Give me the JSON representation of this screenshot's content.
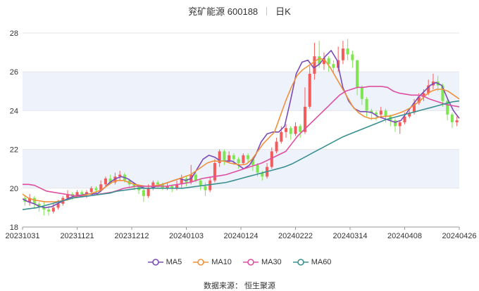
{
  "header": {
    "title": "兖矿能源 600188",
    "period": "日K"
  },
  "source": {
    "text": "数据来源：   恒生聚源"
  },
  "chart_data": {
    "type": "candlestick",
    "title": "兖矿能源 600188",
    "period": "日K",
    "ylim": [
      18,
      28
    ],
    "yticks": [
      "18",
      "20",
      "22",
      "24",
      "26",
      "28"
    ],
    "xtick_labels": [
      "20231031",
      "20231121",
      "20231212",
      "20240103",
      "20240124",
      "20240222",
      "20240314",
      "20240408",
      "20240426"
    ],
    "grid": true,
    "legend_position": "bottom",
    "colors": {
      "up": "#f45b5b",
      "down": "#7ee651",
      "axis": "#333333",
      "grid": "#e6e6e6",
      "band": "#eef2fb"
    },
    "series": [
      {
        "name": "MA5",
        "color": "#7b4bb7",
        "values": [
          19.45,
          19.3,
          19.2,
          19.05,
          19.0,
          19.05,
          19.2,
          19.35,
          19.5,
          19.6,
          19.65,
          19.7,
          19.7,
          19.75,
          20.0,
          20.3,
          20.5,
          20.6,
          20.5,
          20.3,
          20.1,
          20.0,
          20.0,
          20.1,
          20.2,
          20.3,
          20.4,
          20.5,
          20.4,
          20.5,
          21.0,
          21.5,
          21.7,
          21.6,
          21.4,
          21.4,
          21.4,
          21.2,
          21.0,
          21.2,
          21.7,
          22.4,
          22.8,
          22.9,
          22.9,
          23.2,
          24.5,
          25.9,
          26.5,
          26.6,
          26.2,
          26.4,
          26.8,
          27.1,
          26.6,
          25.2,
          24.5,
          24.1,
          23.95,
          23.95,
          23.9,
          23.7,
          23.6,
          23.5,
          23.4,
          23.5,
          23.9,
          24.3,
          24.7,
          25.0,
          25.3,
          25.45,
          25.3,
          24.6,
          24.0,
          23.6
        ]
      },
      {
        "name": "MA10",
        "color": "#f0913b",
        "values": [
          19.7,
          19.5,
          19.4,
          19.35,
          19.3,
          19.3,
          19.3,
          19.35,
          19.4,
          19.5,
          19.6,
          19.65,
          19.7,
          19.8,
          19.9,
          20.1,
          20.3,
          20.4,
          20.4,
          20.3,
          20.2,
          20.15,
          20.1,
          20.1,
          20.15,
          20.2,
          20.3,
          20.4,
          20.5,
          20.6,
          20.7,
          20.9,
          21.1,
          21.3,
          21.4,
          21.4,
          21.4,
          21.3,
          21.25,
          21.2,
          21.25,
          21.5,
          21.9,
          22.3,
          22.6,
          22.9,
          23.7,
          24.5,
          25.2,
          25.8,
          26.1,
          26.3,
          26.5,
          26.7,
          26.6,
          26.2,
          25.7,
          25.2,
          24.7,
          24.2,
          23.9,
          23.7,
          23.6,
          23.6,
          23.7,
          23.7,
          23.75,
          23.85,
          23.95,
          24.1,
          24.3,
          24.5,
          24.8,
          25.0,
          25.1,
          25.1,
          25.0,
          24.8,
          24.6
        ]
      },
      {
        "name": "MA30",
        "color": "#de4fa1",
        "values": [
          20.2,
          20.2,
          20.15,
          20.0,
          19.85,
          19.8,
          19.75,
          19.7,
          19.65,
          19.6,
          19.6,
          19.6,
          19.65,
          19.7,
          19.75,
          19.8,
          19.9,
          20.0,
          20.05,
          20.1,
          20.1,
          20.1,
          20.1,
          20.1,
          20.1,
          20.15,
          20.2,
          20.25,
          20.3,
          20.4,
          20.5,
          20.55,
          20.6,
          20.65,
          20.7,
          20.8,
          20.9,
          21.0,
          21.1,
          21.2,
          21.3,
          21.45,
          21.6,
          21.75,
          21.9,
          22.3,
          22.7,
          23.0,
          23.3,
          23.6,
          23.9,
          24.2,
          24.5,
          24.8,
          25.0,
          25.1,
          25.2,
          25.2,
          25.25,
          25.25,
          25.25,
          25.2,
          25.0,
          24.9,
          24.85,
          24.8,
          24.8,
          24.75,
          24.6,
          24.5,
          24.4,
          24.3,
          24.25,
          24.2
        ]
      },
      {
        "name": "MA60",
        "color": "#3a9090",
        "values": [
          18.9,
          18.95,
          19.0,
          19.1,
          19.2,
          19.3,
          19.4,
          19.5,
          19.55,
          19.6,
          19.65,
          19.7,
          19.75,
          19.85,
          19.9,
          19.95,
          20.0,
          20.0,
          20.0,
          20.0,
          20.0,
          20.0,
          20.0,
          20.05,
          20.1,
          20.15,
          20.2,
          20.25,
          20.3,
          20.4,
          20.5,
          20.6,
          20.7,
          20.8,
          20.9,
          21.0,
          21.1,
          21.25,
          21.45,
          21.65,
          21.85,
          22.05,
          22.25,
          22.45,
          22.65,
          22.8,
          22.95,
          23.1,
          23.25,
          23.4,
          23.55,
          23.65,
          23.75,
          23.85,
          23.95,
          24.05,
          24.15,
          24.25,
          24.35,
          24.45,
          24.5
        ]
      }
    ],
    "candles": [
      [
        19.5,
        19.3,
        19.6,
        19.1
      ],
      [
        19.3,
        19.5,
        19.7,
        19.1
      ],
      [
        19.5,
        19.2,
        19.6,
        19.0
      ],
      [
        19.2,
        19.0,
        19.3,
        18.8
      ],
      [
        19.0,
        18.9,
        19.3,
        18.6
      ],
      [
        18.9,
        18.8,
        19.1,
        18.6
      ],
      [
        18.8,
        19.0,
        19.2,
        18.7
      ],
      [
        19.0,
        19.2,
        19.4,
        18.9
      ],
      [
        19.2,
        19.5,
        19.6,
        19.1
      ],
      [
        19.5,
        19.7,
        19.9,
        19.4
      ],
      [
        19.7,
        19.6,
        19.8,
        19.4
      ],
      [
        19.6,
        19.8,
        19.9,
        19.5
      ],
      [
        19.8,
        19.7,
        19.9,
        19.6
      ],
      [
        19.7,
        19.8,
        19.9,
        19.5
      ],
      [
        19.8,
        20.0,
        20.1,
        19.7
      ],
      [
        20.0,
        19.9,
        20.1,
        19.7
      ],
      [
        19.9,
        20.2,
        20.4,
        19.8
      ],
      [
        20.2,
        20.5,
        20.6,
        20.1
      ],
      [
        20.5,
        20.3,
        20.7,
        20.2
      ],
      [
        20.3,
        20.6,
        20.8,
        20.2
      ],
      [
        20.6,
        20.7,
        20.9,
        20.4
      ],
      [
        20.7,
        20.4,
        20.8,
        20.3
      ],
      [
        20.4,
        20.2,
        20.5,
        20.0
      ],
      [
        20.2,
        20.1,
        20.3,
        19.9
      ],
      [
        20.1,
        19.9,
        20.2,
        19.7
      ],
      [
        19.9,
        19.6,
        20.1,
        19.3
      ],
      [
        19.6,
        20.0,
        20.2,
        19.5
      ],
      [
        20.0,
        20.3,
        20.4,
        19.9
      ],
      [
        20.3,
        20.2,
        20.4,
        20.0
      ],
      [
        20.2,
        20.0,
        20.3,
        19.9
      ],
      [
        20.0,
        20.1,
        20.3,
        19.9
      ],
      [
        20.1,
        20.0,
        20.2,
        19.8
      ],
      [
        20.0,
        20.2,
        20.4,
        19.9
      ],
      [
        20.2,
        20.5,
        20.7,
        20.0
      ],
      [
        20.5,
        20.3,
        20.6,
        20.1
      ],
      [
        20.3,
        20.7,
        21.2,
        20.2
      ],
      [
        20.7,
        20.4,
        20.8,
        20.3
      ],
      [
        20.4,
        20.1,
        20.5,
        19.9
      ],
      [
        20.1,
        19.9,
        20.3,
        19.6
      ],
      [
        19.9,
        20.4,
        20.6,
        19.8
      ],
      [
        20.4,
        21.3,
        21.5,
        20.3
      ],
      [
        21.3,
        21.9,
        22.0,
        21.1
      ],
      [
        21.9,
        21.4,
        22.0,
        21.2
      ],
      [
        21.4,
        21.7,
        21.9,
        21.3
      ],
      [
        21.7,
        21.5,
        21.8,
        21.2
      ],
      [
        21.5,
        21.3,
        21.6,
        21.0
      ],
      [
        21.3,
        21.7,
        21.8,
        21.2
      ],
      [
        21.7,
        21.5,
        21.8,
        21.3
      ],
      [
        21.5,
        21.2,
        21.6,
        20.9
      ],
      [
        21.2,
        20.8,
        21.3,
        20.6
      ],
      [
        20.8,
        20.6,
        20.9,
        20.4
      ],
      [
        20.6,
        21.1,
        21.3,
        20.5
      ],
      [
        21.1,
        21.9,
        22.1,
        21.0
      ],
      [
        21.9,
        22.4,
        22.6,
        21.8
      ],
      [
        22.4,
        22.9,
        23.2,
        22.3
      ],
      [
        22.9,
        23.1,
        23.3,
        22.6
      ],
      [
        23.1,
        22.8,
        23.2,
        22.5
      ],
      [
        22.8,
        23.2,
        23.4,
        22.7
      ],
      [
        23.2,
        22.9,
        23.3,
        22.6
      ],
      [
        22.9,
        24.2,
        25.2,
        22.8
      ],
      [
        24.2,
        25.9,
        26.3,
        24.1
      ],
      [
        25.9,
        26.8,
        27.5,
        25.6
      ],
      [
        26.8,
        26.4,
        27.6,
        26.2
      ],
      [
        26.4,
        26.7,
        27.0,
        26.1
      ],
      [
        26.7,
        26.4,
        26.8,
        26.0
      ],
      [
        26.4,
        26.2,
        26.6,
        25.9
      ],
      [
        26.2,
        26.6,
        27.3,
        26.0
      ],
      [
        26.6,
        27.2,
        27.6,
        26.4
      ],
      [
        27.2,
        26.9,
        27.7,
        26.6
      ],
      [
        26.9,
        26.6,
        27.1,
        26.2
      ],
      [
        26.6,
        25.2,
        26.6,
        24.8
      ],
      [
        25.2,
        24.6,
        25.3,
        24.3
      ],
      [
        24.6,
        24.0,
        24.7,
        23.7
      ],
      [
        24.0,
        23.9,
        24.1,
        23.5
      ],
      [
        23.9,
        23.8,
        24.0,
        23.5
      ],
      [
        23.8,
        24.0,
        24.2,
        23.6
      ],
      [
        24.0,
        23.7,
        24.1,
        23.4
      ],
      [
        23.7,
        23.5,
        23.8,
        23.2
      ],
      [
        23.5,
        23.2,
        23.6,
        22.9
      ],
      [
        23.2,
        23.4,
        23.5,
        22.8
      ],
      [
        23.4,
        23.7,
        23.9,
        23.3
      ],
      [
        23.7,
        23.9,
        24.0,
        23.6
      ],
      [
        23.9,
        24.4,
        24.6,
        23.8
      ],
      [
        24.4,
        24.7,
        24.9,
        24.3
      ],
      [
        24.7,
        24.9,
        25.1,
        24.5
      ],
      [
        24.9,
        25.3,
        25.6,
        24.8
      ],
      [
        25.3,
        25.5,
        25.9,
        25.1
      ],
      [
        25.5,
        25.3,
        25.8,
        25.0
      ],
      [
        25.3,
        24.5,
        25.4,
        24.2
      ],
      [
        24.5,
        23.8,
        24.6,
        23.5
      ],
      [
        23.8,
        23.4,
        23.9,
        23.1
      ],
      [
        23.4,
        23.5,
        23.7,
        23.2
      ]
    ]
  }
}
